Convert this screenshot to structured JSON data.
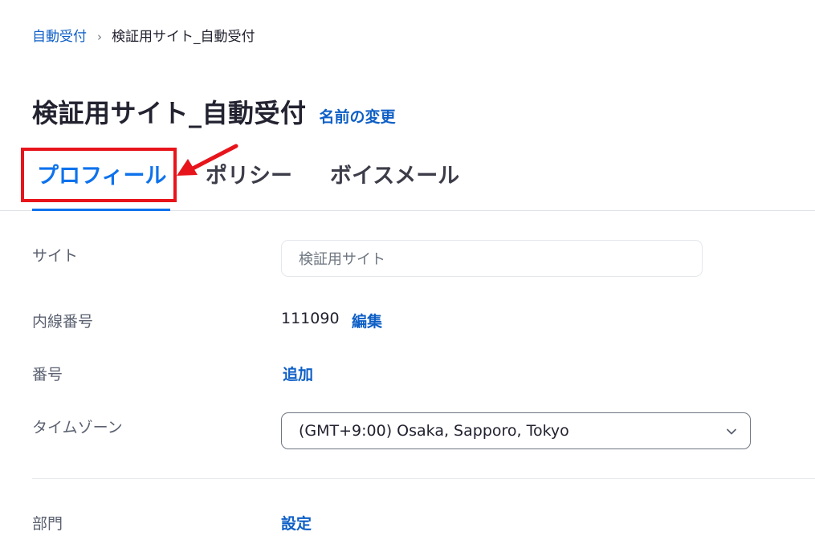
{
  "breadcrumb": {
    "parent": "自動受付",
    "separator": "›",
    "current": "検証用サイト_自動受付"
  },
  "header": {
    "title": "検証用サイト_自動受付",
    "rename_label": "名前の変更"
  },
  "tabs": [
    {
      "label": "プロフィール",
      "active": true
    },
    {
      "label": "ポリシー",
      "active": false
    },
    {
      "label": "ボイスメール",
      "active": false
    }
  ],
  "profile": {
    "site": {
      "label": "サイト",
      "value": "検証用サイト"
    },
    "extension": {
      "label": "内線番号",
      "value": "111090",
      "edit_label": "編集"
    },
    "number": {
      "label": "番号",
      "add_label": "追加"
    },
    "timezone": {
      "label": "タイムゾーン",
      "value": "(GMT+9:00) Osaka, Sapporo, Tokyo"
    },
    "department": {
      "label": "部門",
      "set_label": "設定"
    }
  },
  "icons": {
    "breadcrumb_separator": "chevron-right-icon",
    "select_chevron": "chevron-down-icon",
    "annotation": "red-arrow-annotation"
  },
  "colors": {
    "accent": "#0e72ed",
    "link": "#0e5fc6",
    "annotation": "#e8141b"
  }
}
